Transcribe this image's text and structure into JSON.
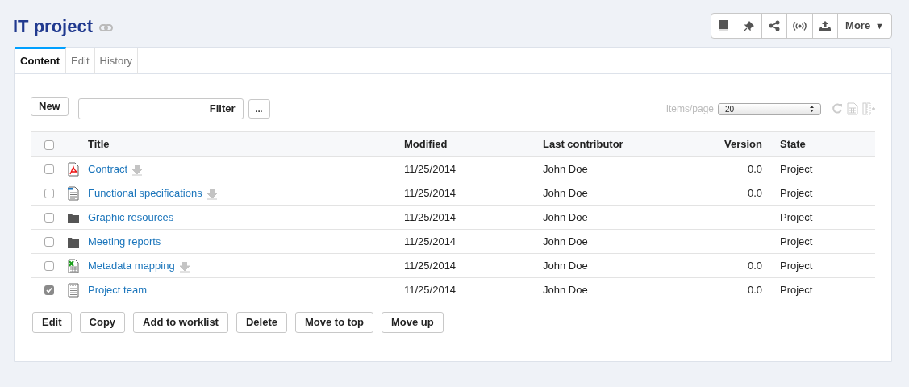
{
  "title": "IT project",
  "toolbar": {
    "more_label": "More",
    "more_caret": "▼"
  },
  "tabs": [
    {
      "label": "Content",
      "selected": true
    },
    {
      "label": "Edit",
      "selected": false
    },
    {
      "label": "History",
      "selected": false
    }
  ],
  "actions": {
    "new_label": "New",
    "filter_label": "Filter",
    "more_label": "...",
    "items_per_page_label": "Items/page",
    "items_per_page_value": "20"
  },
  "table": {
    "columns": [
      "Title",
      "Modified",
      "Last contributor",
      "Version",
      "State"
    ],
    "header_checked": false,
    "rows": [
      {
        "kind": "pdf",
        "title": "Contract",
        "downloadable": true,
        "modified": "11/25/2014",
        "contributor": "John Doe",
        "version": "0.0",
        "state": "Project",
        "checked": false
      },
      {
        "kind": "document",
        "title": "Functional specifications",
        "downloadable": true,
        "modified": "11/25/2014",
        "contributor": "John Doe",
        "version": "0.0",
        "state": "Project",
        "checked": false
      },
      {
        "kind": "folder",
        "title": "Graphic resources",
        "downloadable": false,
        "modified": "11/25/2014",
        "contributor": "John Doe",
        "state": "Project",
        "checked": false
      },
      {
        "kind": "folder",
        "title": "Meeting reports",
        "downloadable": false,
        "modified": "11/25/2014",
        "contributor": "John Doe",
        "state": "Project",
        "checked": false
      },
      {
        "kind": "spreadsheet",
        "title": "Metadata mapping",
        "downloadable": true,
        "modified": "11/25/2014",
        "contributor": "John Doe",
        "version": "0.0",
        "state": "Project",
        "checked": false
      },
      {
        "kind": "page",
        "title": "Project team",
        "downloadable": false,
        "modified": "11/25/2014",
        "contributor": "John Doe",
        "version": "0.0",
        "state": "Project",
        "checked": true
      }
    ]
  },
  "bottom_buttons": [
    "Edit",
    "Copy",
    "Add to worklist",
    "Delete",
    "Move to top",
    "Move up"
  ]
}
